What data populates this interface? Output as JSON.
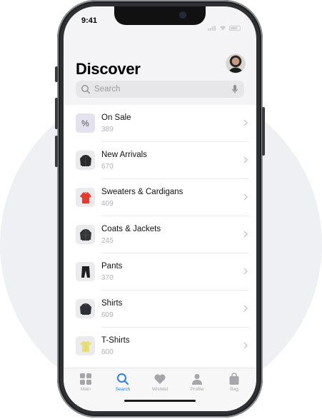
{
  "status_bar": {
    "time": "9:41"
  },
  "header": {
    "title": "Discover"
  },
  "search": {
    "placeholder": "Search"
  },
  "categories": [
    {
      "label": "On Sale",
      "count": "389",
      "icon": "percent-icon"
    },
    {
      "label": "New Arrivals",
      "count": "670",
      "icon": "jacket-thumbnail"
    },
    {
      "label": "Sweaters & Cardigans",
      "count": "409",
      "icon": "sweater-thumbnail"
    },
    {
      "label": "Coats & Jackets",
      "count": "245",
      "icon": "coat-thumbnail"
    },
    {
      "label": "Pants",
      "count": "370",
      "icon": "pants-thumbnail"
    },
    {
      "label": "Shirts",
      "count": "609",
      "icon": "shirt-thumbnail"
    },
    {
      "label": "T-Shirts",
      "count": "600",
      "icon": "tshirt-thumbnail"
    }
  ],
  "sale_symbol": "%",
  "tabbar": {
    "items": [
      {
        "label": "Main",
        "icon": "grid-icon"
      },
      {
        "label": "Search",
        "icon": "search-icon",
        "active": true
      },
      {
        "label": "Wishlist",
        "icon": "heart-icon"
      },
      {
        "label": "Profile",
        "icon": "person-icon"
      },
      {
        "label": "Bag",
        "icon": "bag-icon"
      }
    ]
  },
  "colors": {
    "accent": "#2f7ef6",
    "sweater": "#e23b2e",
    "tshirt": "#e7e07a"
  }
}
